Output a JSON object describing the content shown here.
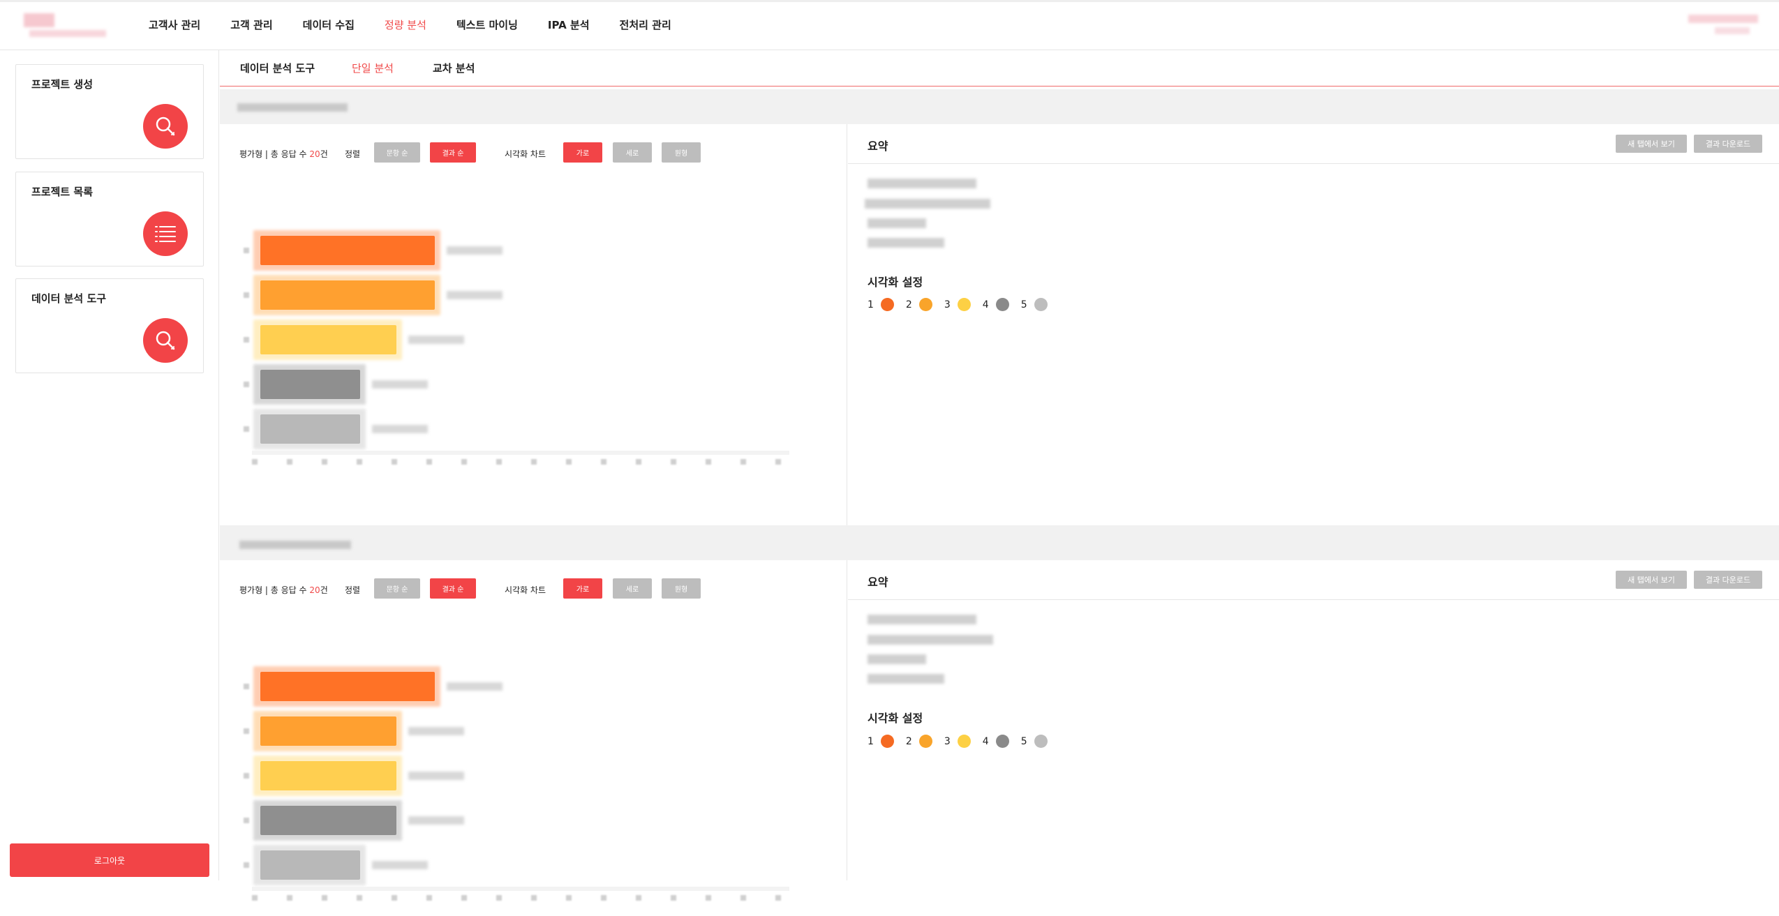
{
  "nav": {
    "items": [
      "고객사 관리",
      "고객 관리",
      "데이터 수집",
      "정량 분석",
      "텍스트 마이닝",
      "IPA 분석",
      "전처리 관리"
    ],
    "active_index": 3
  },
  "sidebar": {
    "cards": [
      {
        "title": "프로젝트 생성",
        "icon": "search-icon"
      },
      {
        "title": "프로젝트 목록",
        "icon": "list-icon"
      },
      {
        "title": "데이터 분석 도구",
        "icon": "search-icon"
      }
    ],
    "logout_label": "로그아웃"
  },
  "subtabs": {
    "items": [
      "데이터 분석 도구",
      "단일 분석",
      "교차 분석"
    ],
    "active_index": 1
  },
  "sections": [
    {
      "controls": {
        "type_label": "평가형 | 총 응답 수 ",
        "count": "20",
        "count_suffix": "건",
        "sort_label": "정렬",
        "sort_options": [
          "문항 순",
          "결과 순"
        ],
        "sort_active": 1,
        "viz_label": "시각화 차트",
        "viz_options": [
          "가로",
          "세로",
          "원형"
        ],
        "viz_active": 0
      },
      "chart_data": {
        "type": "bar",
        "orientation": "horizontal",
        "values": [
          1.0,
          1.0,
          0.78,
          0.57,
          0.57
        ],
        "colors": [
          "#ff7226",
          "#ffa030",
          "#ffcf50",
          "#8f8f8f",
          "#b8b8b8"
        ]
      },
      "summary": {
        "title": "요약",
        "btn_new_tab": "새 탭에서 보기",
        "btn_download": "결과 다운로드",
        "vis_title": "시각화 설정"
      }
    },
    {
      "controls": {
        "type_label": "평가형 | 총 응답 수 ",
        "count": "20",
        "count_suffix": "건",
        "sort_label": "정렬",
        "sort_options": [
          "문항 순",
          "결과 순"
        ],
        "sort_active": 1,
        "viz_label": "시각화 차트",
        "viz_options": [
          "가로",
          "세로",
          "원형"
        ],
        "viz_active": 0
      },
      "chart_data": {
        "type": "bar",
        "orientation": "horizontal",
        "values": [
          1.0,
          0.78,
          0.78,
          0.78,
          0.57
        ],
        "colors": [
          "#ff7226",
          "#ffa030",
          "#ffcf50",
          "#8f8f8f",
          "#b8b8b8"
        ]
      },
      "summary": {
        "title": "요약",
        "btn_new_tab": "새 탭에서 보기",
        "btn_download": "결과 다운로드",
        "vis_title": "시각화 설정"
      }
    }
  ],
  "legend": [
    {
      "label": "1",
      "color": "#f56a22"
    },
    {
      "label": "2",
      "color": "#f9a42a"
    },
    {
      "label": "3",
      "color": "#fdd044"
    },
    {
      "label": "4",
      "color": "#8a8a8a"
    },
    {
      "label": "5",
      "color": "#bdbdbd"
    }
  ]
}
